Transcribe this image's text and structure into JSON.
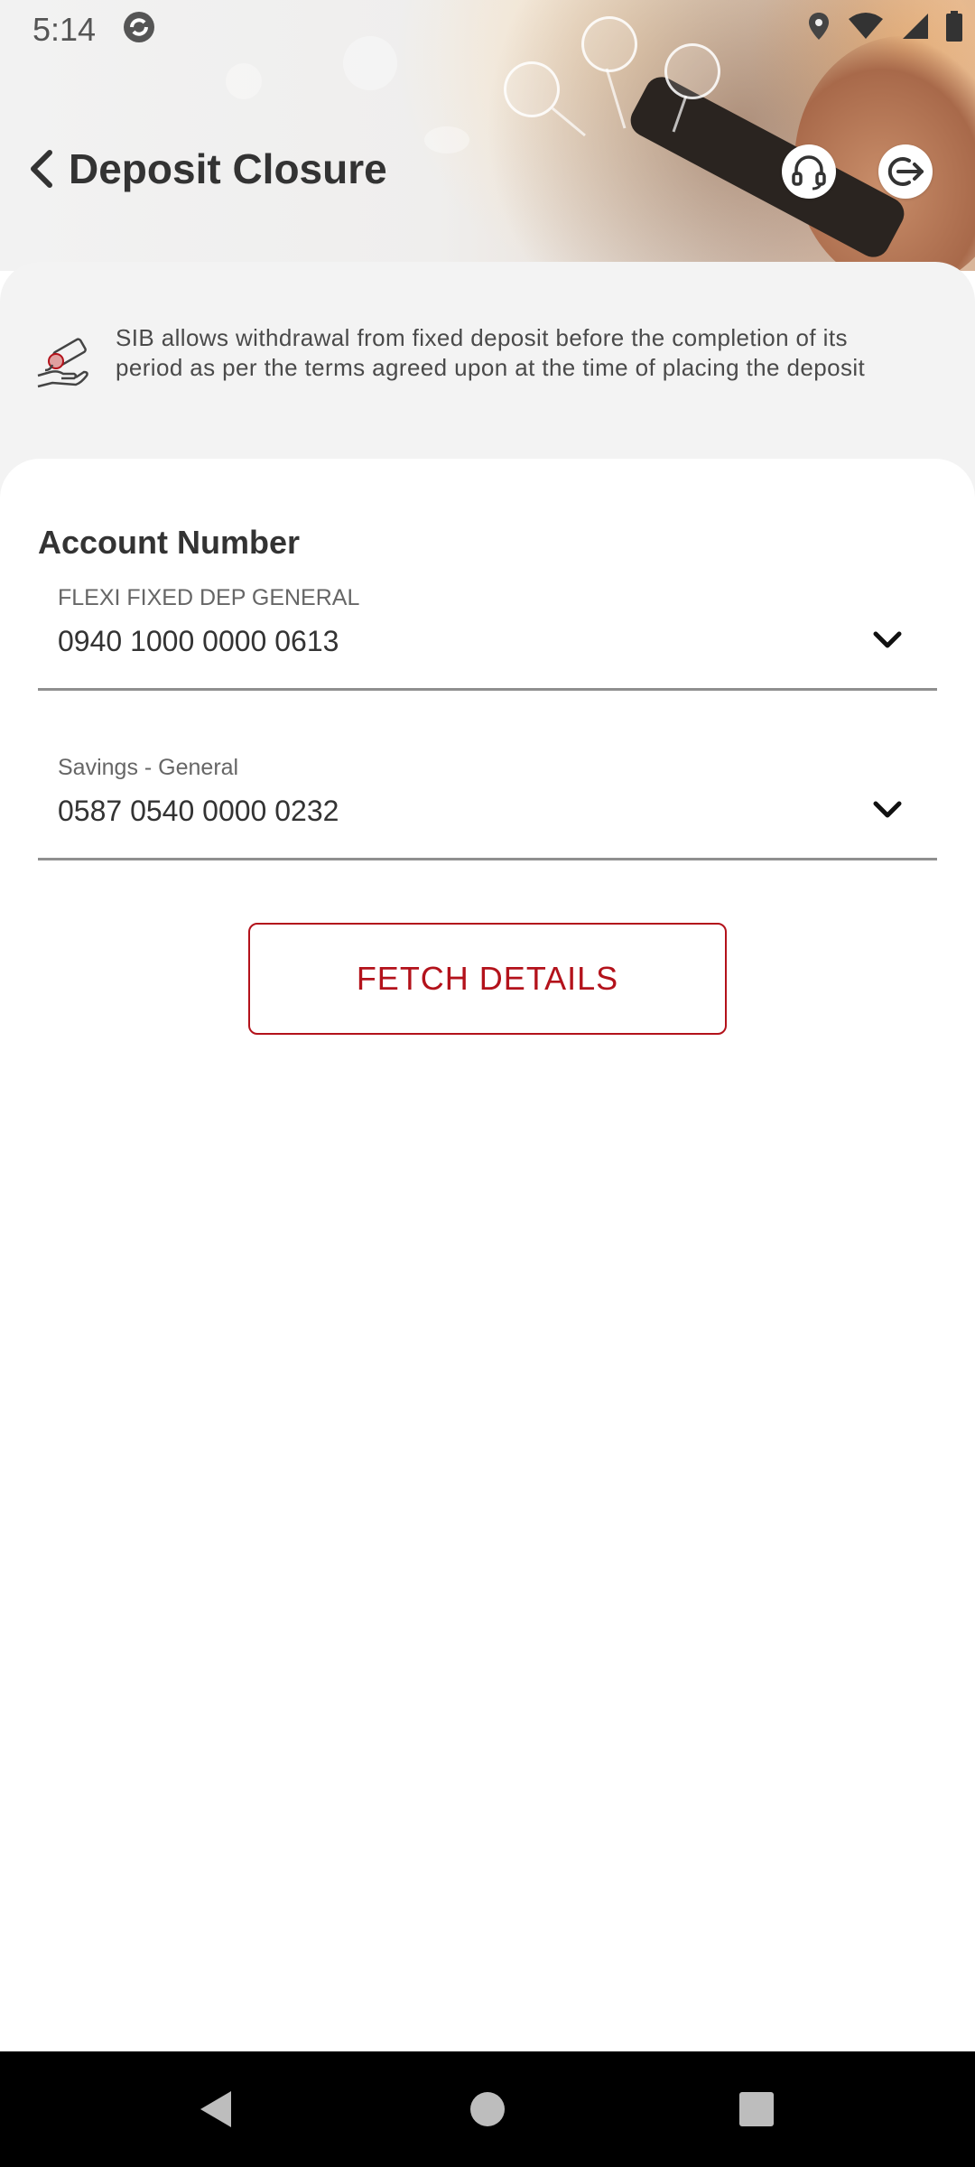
{
  "status_bar": {
    "time": "5:14",
    "icons": [
      "sync-icon",
      "location-icon",
      "wifi-icon",
      "signal-icon",
      "battery-icon"
    ]
  },
  "header": {
    "title": "Deposit Closure",
    "back_icon": "chevron-left-icon",
    "support_icon": "headset-icon",
    "logout_icon": "logout-icon"
  },
  "info": {
    "icon": "hand-money-icon",
    "text": "SIB allows withdrawal from fixed deposit before the completion of its period as per the terms agreed upon at the time of placing the deposit"
  },
  "form": {
    "section_title": "Account Number",
    "deposit_account": {
      "label": "FLEXI FIXED DEP GENERAL",
      "value": "0940 1000 0000 0613"
    },
    "credit_account": {
      "label": "Savings - General",
      "value": "0587 0540 0000 0232"
    },
    "fetch_label": "FETCH DETAILS"
  },
  "colors": {
    "accent": "#b3121b",
    "text_primary": "#333333",
    "panel_bg": "#f3f3f3",
    "nav_bg": "#000000"
  }
}
